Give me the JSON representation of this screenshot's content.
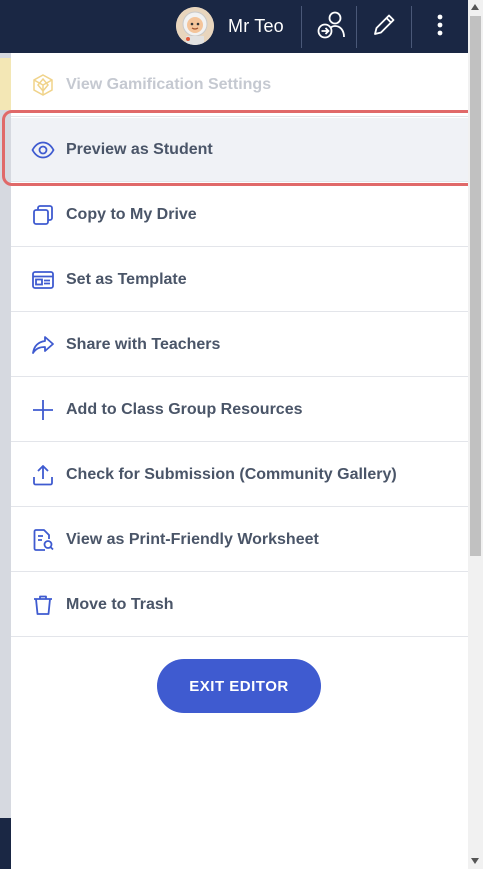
{
  "header": {
    "user_name": "Mr Teo",
    "avatar_icon": "astronaut-avatar",
    "actions": [
      {
        "icon": "switch-user-icon"
      },
      {
        "icon": "pencil-icon"
      },
      {
        "icon": "more-vertical-icon"
      }
    ]
  },
  "menu": {
    "items": [
      {
        "label": "View Gamification Settings",
        "icon": "gamification-icon",
        "state": "disabled"
      },
      {
        "label": "Preview as Student",
        "icon": "eye-icon",
        "state": "highlighted"
      },
      {
        "label": "Copy to My Drive",
        "icon": "copy-icon",
        "state": "normal"
      },
      {
        "label": "Set as Template",
        "icon": "template-icon",
        "state": "normal"
      },
      {
        "label": "Share with Teachers",
        "icon": "share-icon",
        "state": "normal"
      },
      {
        "label": "Add to Class Group Resources",
        "icon": "plus-icon",
        "state": "normal"
      },
      {
        "label": "Check for Submission (Community Gallery)",
        "icon": "upload-icon",
        "state": "normal"
      },
      {
        "label": "View as Print-Friendly Worksheet",
        "icon": "worksheet-search-icon",
        "state": "normal"
      },
      {
        "label": "Move to Trash",
        "icon": "trash-icon",
        "state": "normal"
      }
    ],
    "exit_label": "EXIT EDITOR"
  },
  "colors": {
    "header_bg": "#1a2744",
    "icon_blue": "#3f5bd0",
    "label_text": "#4a5568",
    "disabled_text": "#c5c9d1",
    "highlight_border": "#e06969",
    "exit_button": "#3f5bd0"
  }
}
